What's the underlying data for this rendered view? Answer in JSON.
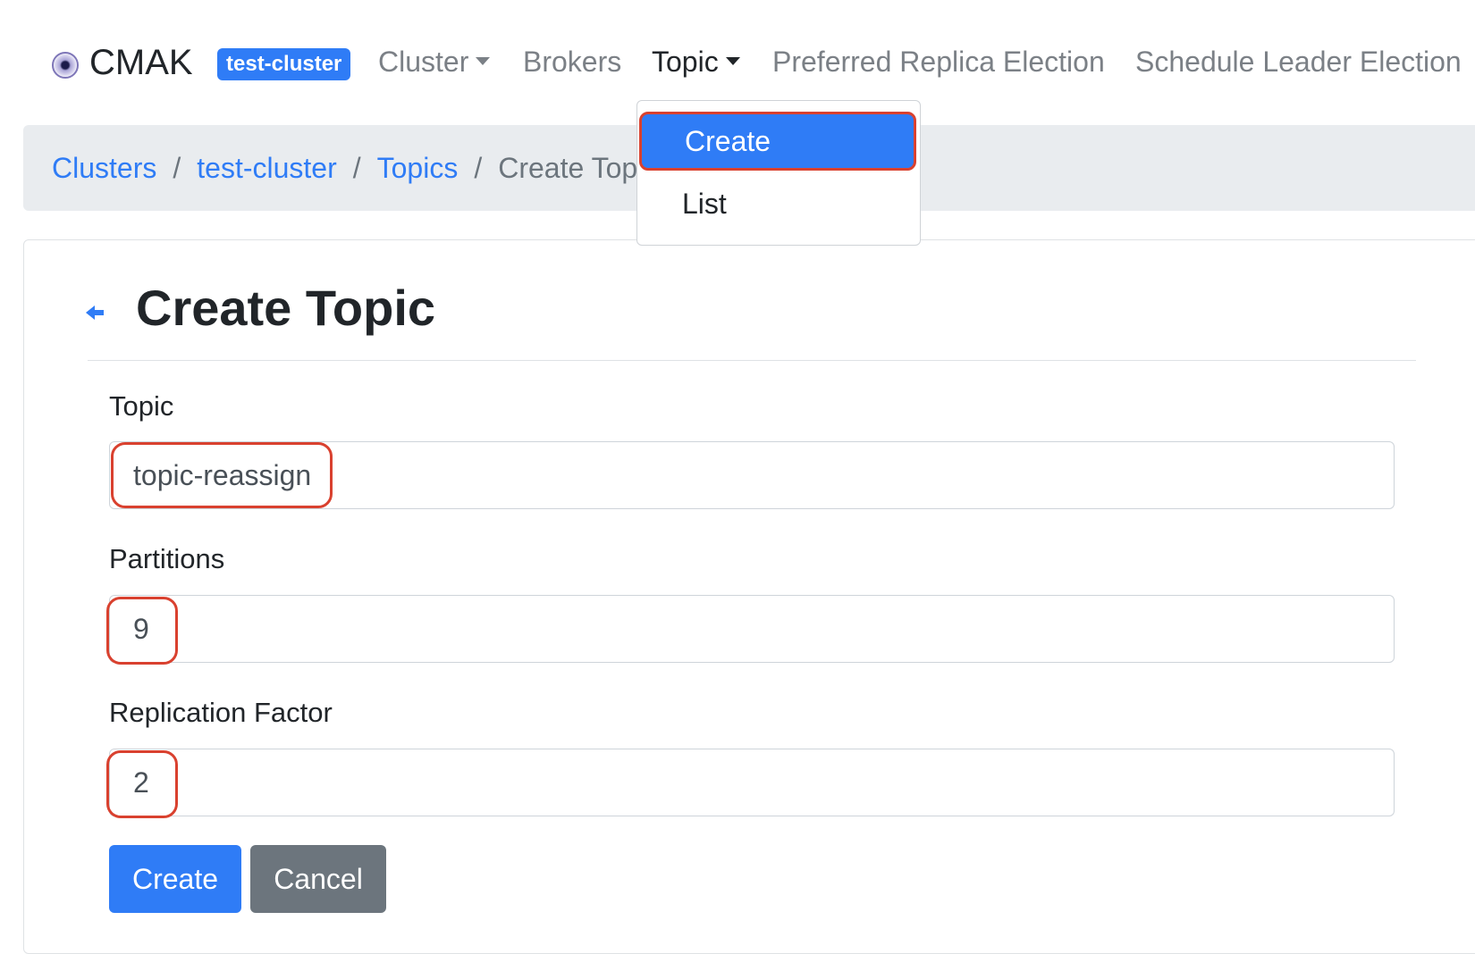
{
  "navbar": {
    "brand": "CMAK",
    "cluster_badge": "test-cluster",
    "items": [
      {
        "label": "Cluster",
        "dropdown": true,
        "active": false
      },
      {
        "label": "Brokers",
        "dropdown": false,
        "active": false
      },
      {
        "label": "Topic",
        "dropdown": true,
        "active": true
      },
      {
        "label": "Preferred Replica Election",
        "dropdown": false,
        "active": false
      },
      {
        "label": "Schedule Leader Election",
        "dropdown": false,
        "active": false
      }
    ]
  },
  "topic_dropdown": {
    "items": [
      {
        "label": "Create",
        "selected": true
      },
      {
        "label": "List",
        "selected": false
      }
    ]
  },
  "breadcrumb": {
    "items": [
      "Clusters",
      "test-cluster",
      "Topics"
    ],
    "current": "Create Topic",
    "separator": "/"
  },
  "page": {
    "title": "Create Topic",
    "back_icon": "arrow-left-icon"
  },
  "form": {
    "topic": {
      "label": "Topic",
      "value": "topic-reassign"
    },
    "partitions": {
      "label": "Partitions",
      "value": "9"
    },
    "replication_factor": {
      "label": "Replication Factor",
      "value": "2"
    }
  },
  "buttons": {
    "create": "Create",
    "cancel": "Cancel"
  },
  "colors": {
    "primary": "#2f7cf6",
    "secondary": "#6c757d",
    "highlight": "#d9412f",
    "breadcrumb_bg": "#e9ecef"
  }
}
